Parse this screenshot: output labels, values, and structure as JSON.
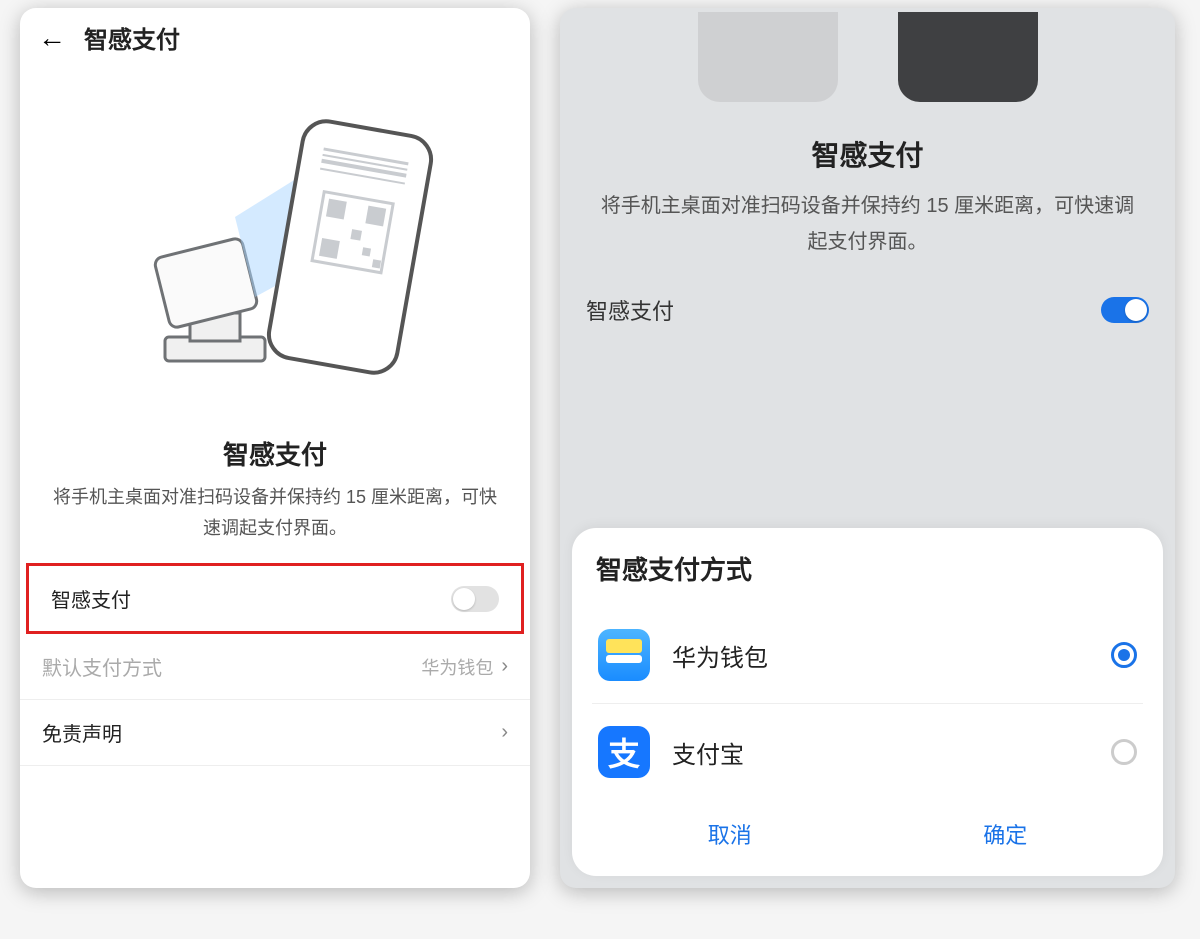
{
  "left": {
    "header_title": "智感支付",
    "feature_title": "智感支付",
    "feature_desc": "将手机主桌面对准扫码设备并保持约 15 厘米距离，可快速调起支付界面。",
    "toggle_row_label": "智感支付",
    "toggle_on": false,
    "default_method_label": "默认支付方式",
    "default_method_value": "华为钱包",
    "disclaimer_label": "免责声明"
  },
  "right": {
    "feature_title": "智感支付",
    "feature_desc": "将手机主桌面对准扫码设备并保持约 15 厘米距离，可快速调起支付界面。",
    "toggle_row_label": "智感支付",
    "toggle_on": true,
    "modal": {
      "title": "智感支付方式",
      "options": [
        {
          "label": "华为钱包",
          "icon": "huawei-wallet",
          "selected": true
        },
        {
          "label": "支付宝",
          "icon": "alipay",
          "selected": false
        }
      ],
      "cancel": "取消",
      "confirm": "确定"
    }
  }
}
